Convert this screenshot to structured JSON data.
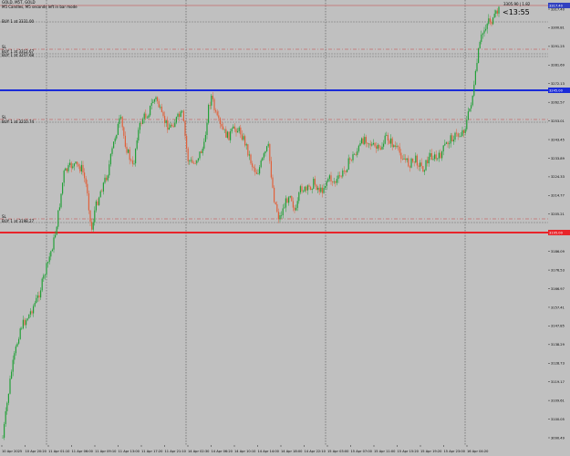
{
  "symbol_label": "GOLD, M5T, GOLD",
  "sub_label": "M5 Candles, M5 seconds left in bar mode",
  "buy_labels": [
    "BUY 1 at 3331.00",
    "SL",
    "BUY 1 at 3312.67",
    "BUY 1 at 3257.68",
    "SL",
    "BUY 1 at 3210.74",
    "SL",
    "BUY 1 at 3198.27"
  ],
  "timer_label": "<13:55",
  "top_price_label": "3305.90 | 1.82",
  "price_badges": {
    "blue": "3245.00",
    "red": "3195.00",
    "top": "3317.40"
  },
  "colors": {
    "background": "#c0c0c0",
    "bull": "#22a038",
    "bear": "#e0603a",
    "blue_line": "#1a2bd8",
    "red_line": "#e8242a",
    "dash_red": "#c84040",
    "grid": "#505050"
  },
  "y_axis_labels": [
    "3317.40",
    "3300.81",
    "3291.25",
    "3281.69",
    "3272.13",
    "3262.57",
    "3253.01",
    "3243.45",
    "3233.89",
    "3224.33",
    "3214.77",
    "3205.21",
    "3195.65",
    "3186.09",
    "3176.53",
    "3166.97",
    "3157.41",
    "3147.85",
    "3138.29",
    "3128.73",
    "3119.17",
    "3109.61",
    "3100.05",
    "3090.49"
  ],
  "x_axis_labels": [
    "10 Apr 2025",
    "10 Apr 20:20",
    "11 Apr 01:10",
    "11 Apr 06:00",
    "11 Apr 09:10",
    "11 Apr 13:00",
    "11 Apr 17:20",
    "11 Apr 21:10",
    "14 Apr 02:30",
    "14 Apr 06:20",
    "14 Apr 10:10",
    "14 Apr 14:00",
    "14 Apr 18:00",
    "14 Apr 22:10",
    "15 Apr 03:00",
    "15 Apr 07:00",
    "15 Apr 11:00",
    "15 Apr 15:20",
    "15 Apr 19:20",
    "15 Apr 23:00",
    "16 Apr 04:20"
  ]
}
